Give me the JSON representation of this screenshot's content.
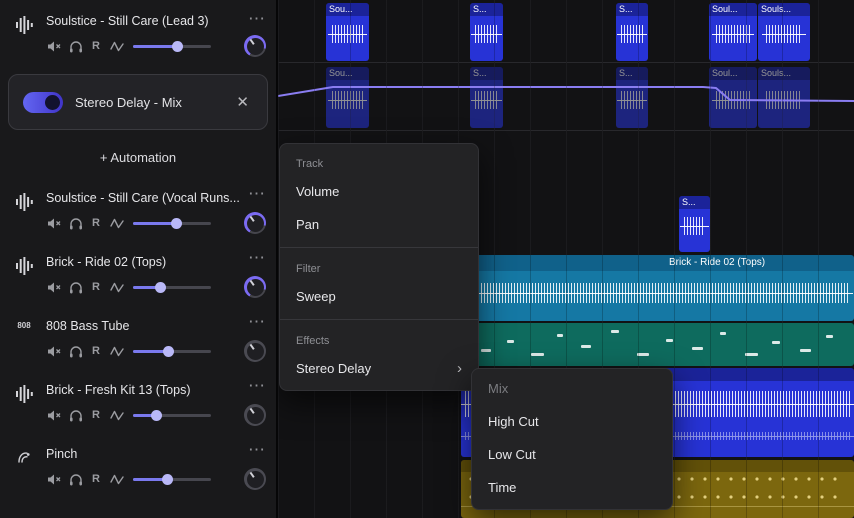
{
  "colors": {
    "accent_indigo": "#6c5ef0",
    "automation_purple": "#8a7df2",
    "clip_blue": "#2733d6",
    "clip_teal": "#1578a4",
    "clip_green": "#0e6b5e",
    "clip_olive": "#7c670e"
  },
  "icons": {
    "menu_dots": "⋯",
    "close": "✕",
    "chevron_right": "›"
  },
  "labels": {
    "record": "R"
  },
  "sidebar": {
    "top_track": {
      "name": "Soulstice - Still Care (Lead 3)",
      "volume_percent": 57
    },
    "effect_card": {
      "label": "Stereo Delay - Mix",
      "toggle_on": true
    },
    "automation_button": {
      "label": "+ Automation"
    },
    "tracks": [
      {
        "name": "Soulstice - Still Care (Vocal Runs...",
        "volume_percent": 55
      },
      {
        "name": "Brick - Ride 02 (Tops)",
        "volume_percent": 35
      },
      {
        "name": "808 Bass Tube",
        "icon_label": "808",
        "volume_percent": 45
      },
      {
        "name": "Brick - Fresh Kit 13 (Tops)",
        "volume_percent": 30
      },
      {
        "name": "Pinch",
        "volume_percent": 43
      }
    ]
  },
  "context_menu": {
    "sections": [
      {
        "label": "Track",
        "items": [
          {
            "label": "Volume"
          },
          {
            "label": "Pan"
          }
        ]
      },
      {
        "label": "Filter",
        "items": [
          {
            "label": "Sweep"
          }
        ]
      },
      {
        "label": "Effects",
        "items": [
          {
            "label": "Stereo Delay",
            "has_submenu": true
          }
        ]
      }
    ]
  },
  "submenu": {
    "items": [
      {
        "label": "Mix",
        "disabled": true
      },
      {
        "label": "High Cut"
      },
      {
        "label": "Low Cut"
      },
      {
        "label": "Time"
      }
    ]
  },
  "timeline": {
    "lane1_clips": [
      {
        "label": "Sou..."
      },
      {
        "label": "S..."
      },
      {
        "label": "S..."
      },
      {
        "label": "Soul..."
      },
      {
        "label": "Souls..."
      }
    ],
    "lane2_clips": [
      {
        "label": "Sou..."
      },
      {
        "label": "S..."
      },
      {
        "label": "S..."
      },
      {
        "label": "Soul..."
      },
      {
        "label": "Souls..."
      }
    ],
    "solo_clip": {
      "label": "S..."
    },
    "ride_clip": {
      "label": "Brick - Ride 02 (Tops)"
    }
  }
}
